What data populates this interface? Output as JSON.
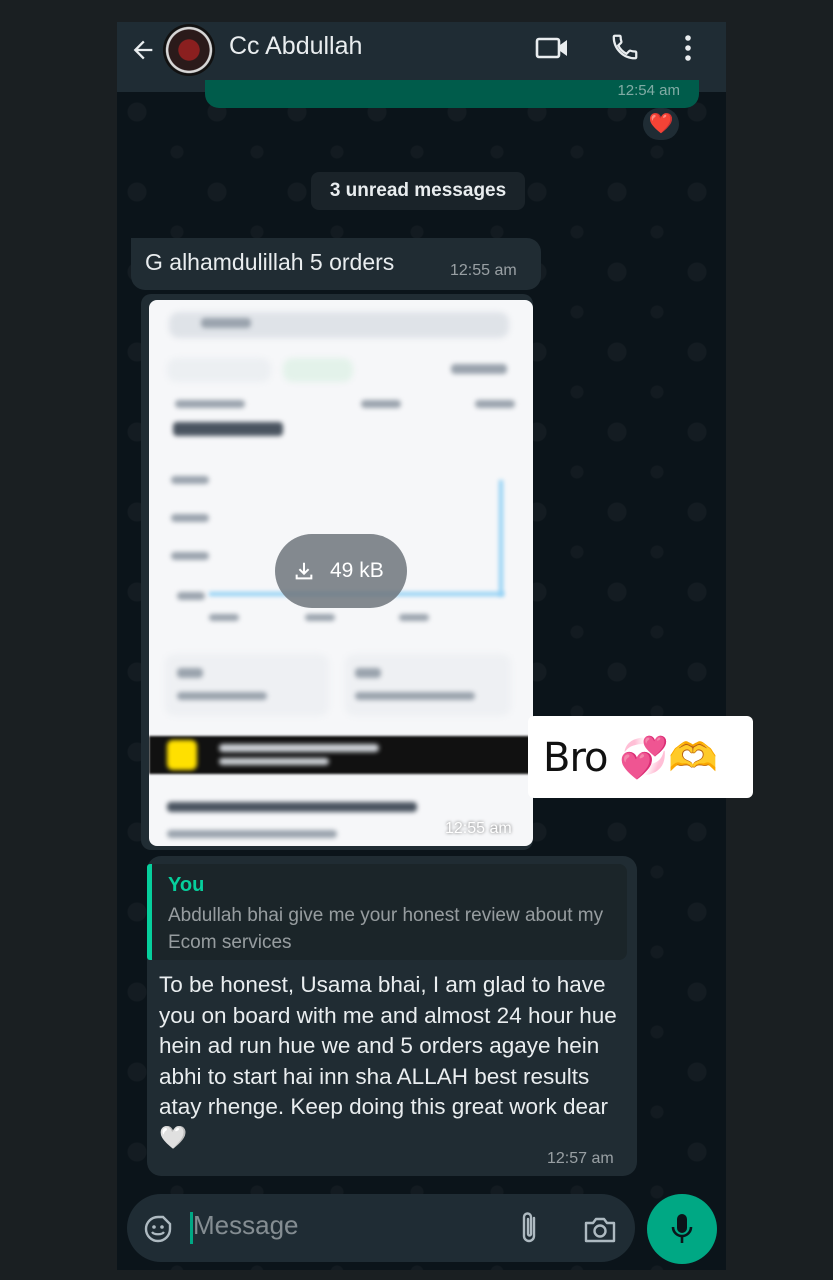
{
  "header": {
    "contact_name": "Cc Abdullah"
  },
  "chat": {
    "top_time": "12:54 am",
    "reaction": "❤️",
    "unread_banner": "3 unread messages",
    "incoming_message": {
      "text": "G alhamdulillah 5 orders",
      "time": "12:55 am"
    },
    "image_message": {
      "download_size": "49 kB",
      "time": "12:55 am"
    },
    "reply_message": {
      "quote_author": "You",
      "quote_text": "Abdullah bhai give me your honest review about my Ecom services",
      "text": "To be honest, Usama bhai, I am glad to have you on board with me and almost 24 hour hue hein ad run hue we and 5 orders agaye hein abhi to start hai inn sha ALLAH best results atay rhenge. Keep doing this great work dear 🤍",
      "time": "12:57 am"
    }
  },
  "overlay": {
    "text": "Bro 💞🫶"
  },
  "composer": {
    "placeholder": "Message"
  },
  "colors": {
    "header_bg": "#1f2c34",
    "chat_bg": "#0b141a",
    "bubble_incoming": "#202c33",
    "bubble_outgoing": "#005c4b",
    "accent": "#00a884",
    "quote_accent": "#06cf9c"
  },
  "icons": [
    "back-arrow-icon",
    "video-call-icon",
    "phone-icon",
    "more-vert-icon",
    "download-icon",
    "emoji-sticker-icon",
    "attach-icon",
    "camera-icon",
    "mic-icon"
  ]
}
